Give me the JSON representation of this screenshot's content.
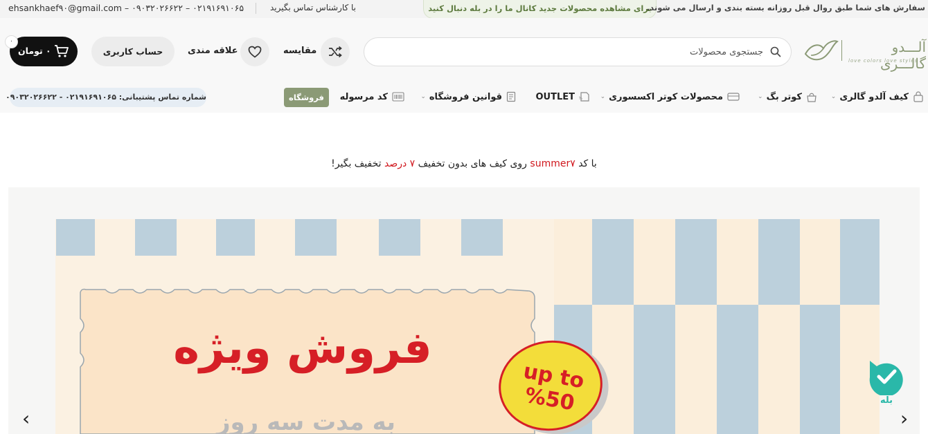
{
  "topbar": {
    "email_phone": "ehsankhaef۹۰@gmail.com – ۰۹۰۳۲۰۲۶۶۲۲ – ۰۲۱۹۱۶۹۱۰۶۵",
    "contact_expert": "با کارشناس تماس بگیرید",
    "channel_notice": "برای مشاهده محصولات جدید کانال ما را در بله دنبال کنید",
    "shipping_notice": "سفارش های شما طبق روال قبل روزانه بسته بندی و ارسال می شوند."
  },
  "header": {
    "logo_name": "آلـــدو گالـــری",
    "logo_tagline": "love colors love styles",
    "search_placeholder": "جستجوی محصولات",
    "compare_label": "مقایسه",
    "wishlist_label": "علاقه مندی",
    "account_label": "حساب کاربری",
    "cart_label": "۰ تومان",
    "cart_count": "۰"
  },
  "nav": {
    "items": [
      {
        "label": "کیف آلدو گالری",
        "icon": "bag-icon",
        "has_dropdown": true
      },
      {
        "label": "کوتر بگ",
        "icon": "handbag-icon",
        "has_dropdown": true
      },
      {
        "label": "محصولات کوتر اکسسوری",
        "icon": "wallet-icon",
        "has_dropdown": true
      },
      {
        "label": "OUTLET",
        "icon": "tag-icon",
        "has_dropdown": false
      },
      {
        "label": "قوانین فروشگاه",
        "icon": "document-icon",
        "has_dropdown": true
      },
      {
        "label": "کد مرسوله",
        "icon": "barcode-icon",
        "has_dropdown": false
      }
    ],
    "shop_button": "فروشگاه",
    "support_phone": "شماره تماس پشتیبانی: ۰۲۱۹۱۶۹۱۰۶۵ - ۰۹۰۳۲۰۲۶۶۲۲"
  },
  "promo": {
    "before": "با کد",
    "code": "summer۷",
    "middle": "روی کیف های بدون تخفیف",
    "discount": "۷ درصد",
    "after": "تخفیف بگیر!"
  },
  "banner": {
    "headline": "فروش ویژه",
    "subline": "به مدت سه روز",
    "badge": "up to %50"
  },
  "bale_widget": {
    "label": "بله"
  },
  "colors": {
    "accent_green": "#8b9a76",
    "promo_red": "#d0171d",
    "cart_black": "#111111",
    "banner_blue": "#bcd0dc",
    "banner_cream": "#fbeedb"
  }
}
